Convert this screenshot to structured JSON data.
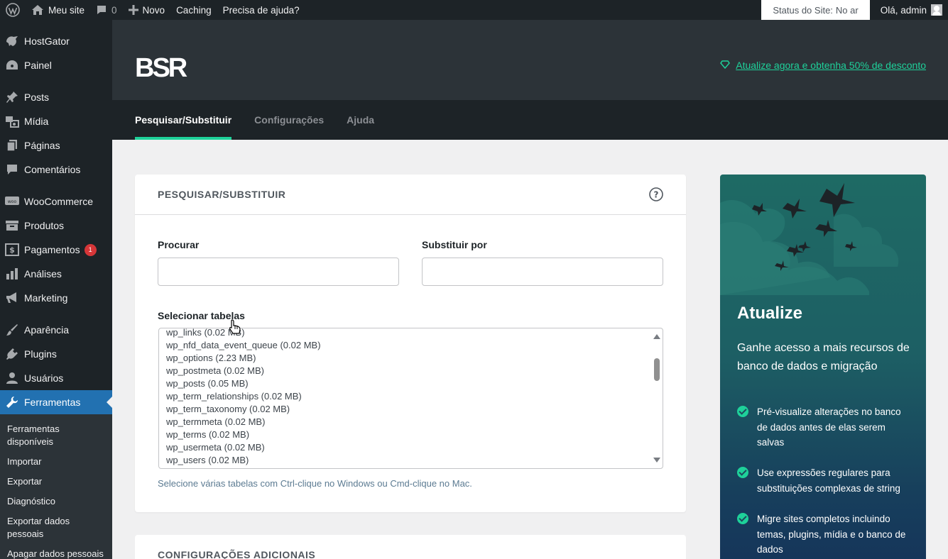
{
  "admin_bar": {
    "site_name": "Meu site",
    "comments_count": "0",
    "new_label": "Novo",
    "caching_label": "Caching",
    "help_label": "Precisa de ajuda?",
    "status_label": "Status do Site:",
    "status_value": "No ar",
    "greeting": "Olá, admin"
  },
  "sidebar": {
    "items": [
      {
        "label": "HostGator",
        "icon": "hostgator-icon"
      },
      {
        "label": "Painel",
        "icon": "dashboard-icon"
      },
      {
        "label": "Posts",
        "icon": "pin-icon"
      },
      {
        "label": "Mídia",
        "icon": "media-icon"
      },
      {
        "label": "Páginas",
        "icon": "pages-icon"
      },
      {
        "label": "Comentários",
        "icon": "comments-icon"
      },
      {
        "label": "WooCommerce",
        "icon": "woocommerce-icon"
      },
      {
        "label": "Produtos",
        "icon": "archive-icon"
      },
      {
        "label": "Pagamentos",
        "icon": "payments-icon",
        "badge": "1"
      },
      {
        "label": "Análises",
        "icon": "chart-icon"
      },
      {
        "label": "Marketing",
        "icon": "megaphone-icon"
      },
      {
        "label": "Aparência",
        "icon": "brush-icon"
      },
      {
        "label": "Plugins",
        "icon": "plugin-icon"
      },
      {
        "label": "Usuários",
        "icon": "users-icon"
      },
      {
        "label": "Ferramentas",
        "icon": "wrench-icon"
      }
    ],
    "submenu": [
      "Ferramentas disponíveis",
      "Importar",
      "Exportar",
      "Diagnóstico",
      "Exportar dados pessoais",
      "Apagar dados pessoais"
    ]
  },
  "header": {
    "logo_text": "BSR",
    "upgrade_link": "Atualize agora e obtenha 50% de desconto"
  },
  "tabs": [
    "Pesquisar/Substituir",
    "Configurações",
    "Ajuda"
  ],
  "search_card": {
    "title": "PESQUISAR/SUBSTITUIR",
    "search_label": "Procurar",
    "search_value": "",
    "replace_label": "Substituir por",
    "replace_value": "",
    "tables_label": "Selecionar tabelas",
    "tables": [
      "wp_links (0.02 MB)",
      "wp_nfd_data_event_queue (0.02 MB)",
      "wp_options (2.23 MB)",
      "wp_postmeta (0.02 MB)",
      "wp_posts (0.05 MB)",
      "wp_term_relationships (0.02 MB)",
      "wp_term_taxonomy (0.02 MB)",
      "wp_termmeta (0.02 MB)",
      "wp_terms (0.02 MB)",
      "wp_usermeta (0.02 MB)",
      "wp_users (0.02 MB)"
    ],
    "hint": "Selecione várias tabelas com Ctrl-clique no Windows ou Cmd-clique no Mac."
  },
  "extra_card": {
    "title": "CONFIGURAÇÕES ADICIONAIS"
  },
  "promo": {
    "title": "Atualize",
    "subtitle": "Ganhe acesso a mais recursos de banco de dados e migração",
    "features": [
      "Pré-visualize alterações no banco de dados antes de elas serem salvas",
      "Use expressões regulares para substituições complexas de string",
      "Migre sites completos incluindo temas, plugins, mídia e o banco de dados"
    ]
  },
  "colors": {
    "accent": "#1ed19a",
    "admin_dark": "#1d2327",
    "active_menu": "#2271b1",
    "badge": "#d63638"
  }
}
